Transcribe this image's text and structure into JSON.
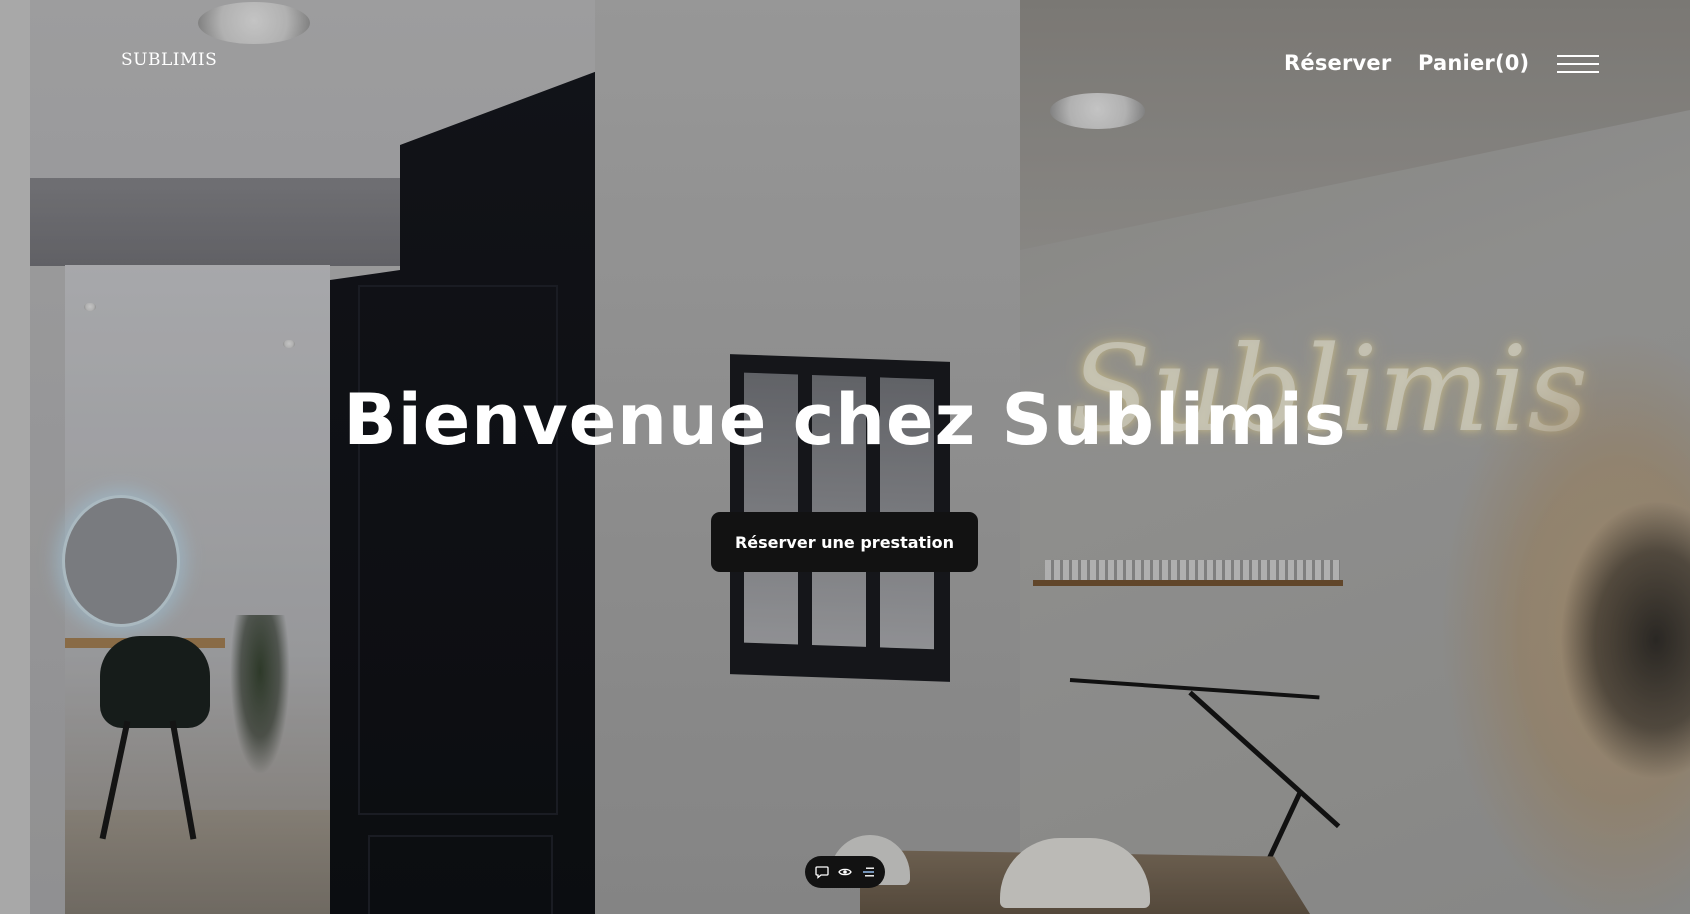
{
  "header": {
    "logo_text": "SUBLIMIS",
    "nav": {
      "reserve_label": "Réserver",
      "cart_label": "Panier(0)"
    },
    "menu_icon": "hamburger-menu-icon"
  },
  "hero": {
    "title": "Bienvenue chez Sublimis",
    "cta_label": "Réserver une prestation",
    "background_neon_text": "Sublimis"
  },
  "toolbar": {
    "icons": [
      "chat-bubble-icon",
      "eye-icon",
      "list-icon"
    ]
  },
  "colors": {
    "button_bg": "#121212",
    "text": "#ffffff"
  }
}
